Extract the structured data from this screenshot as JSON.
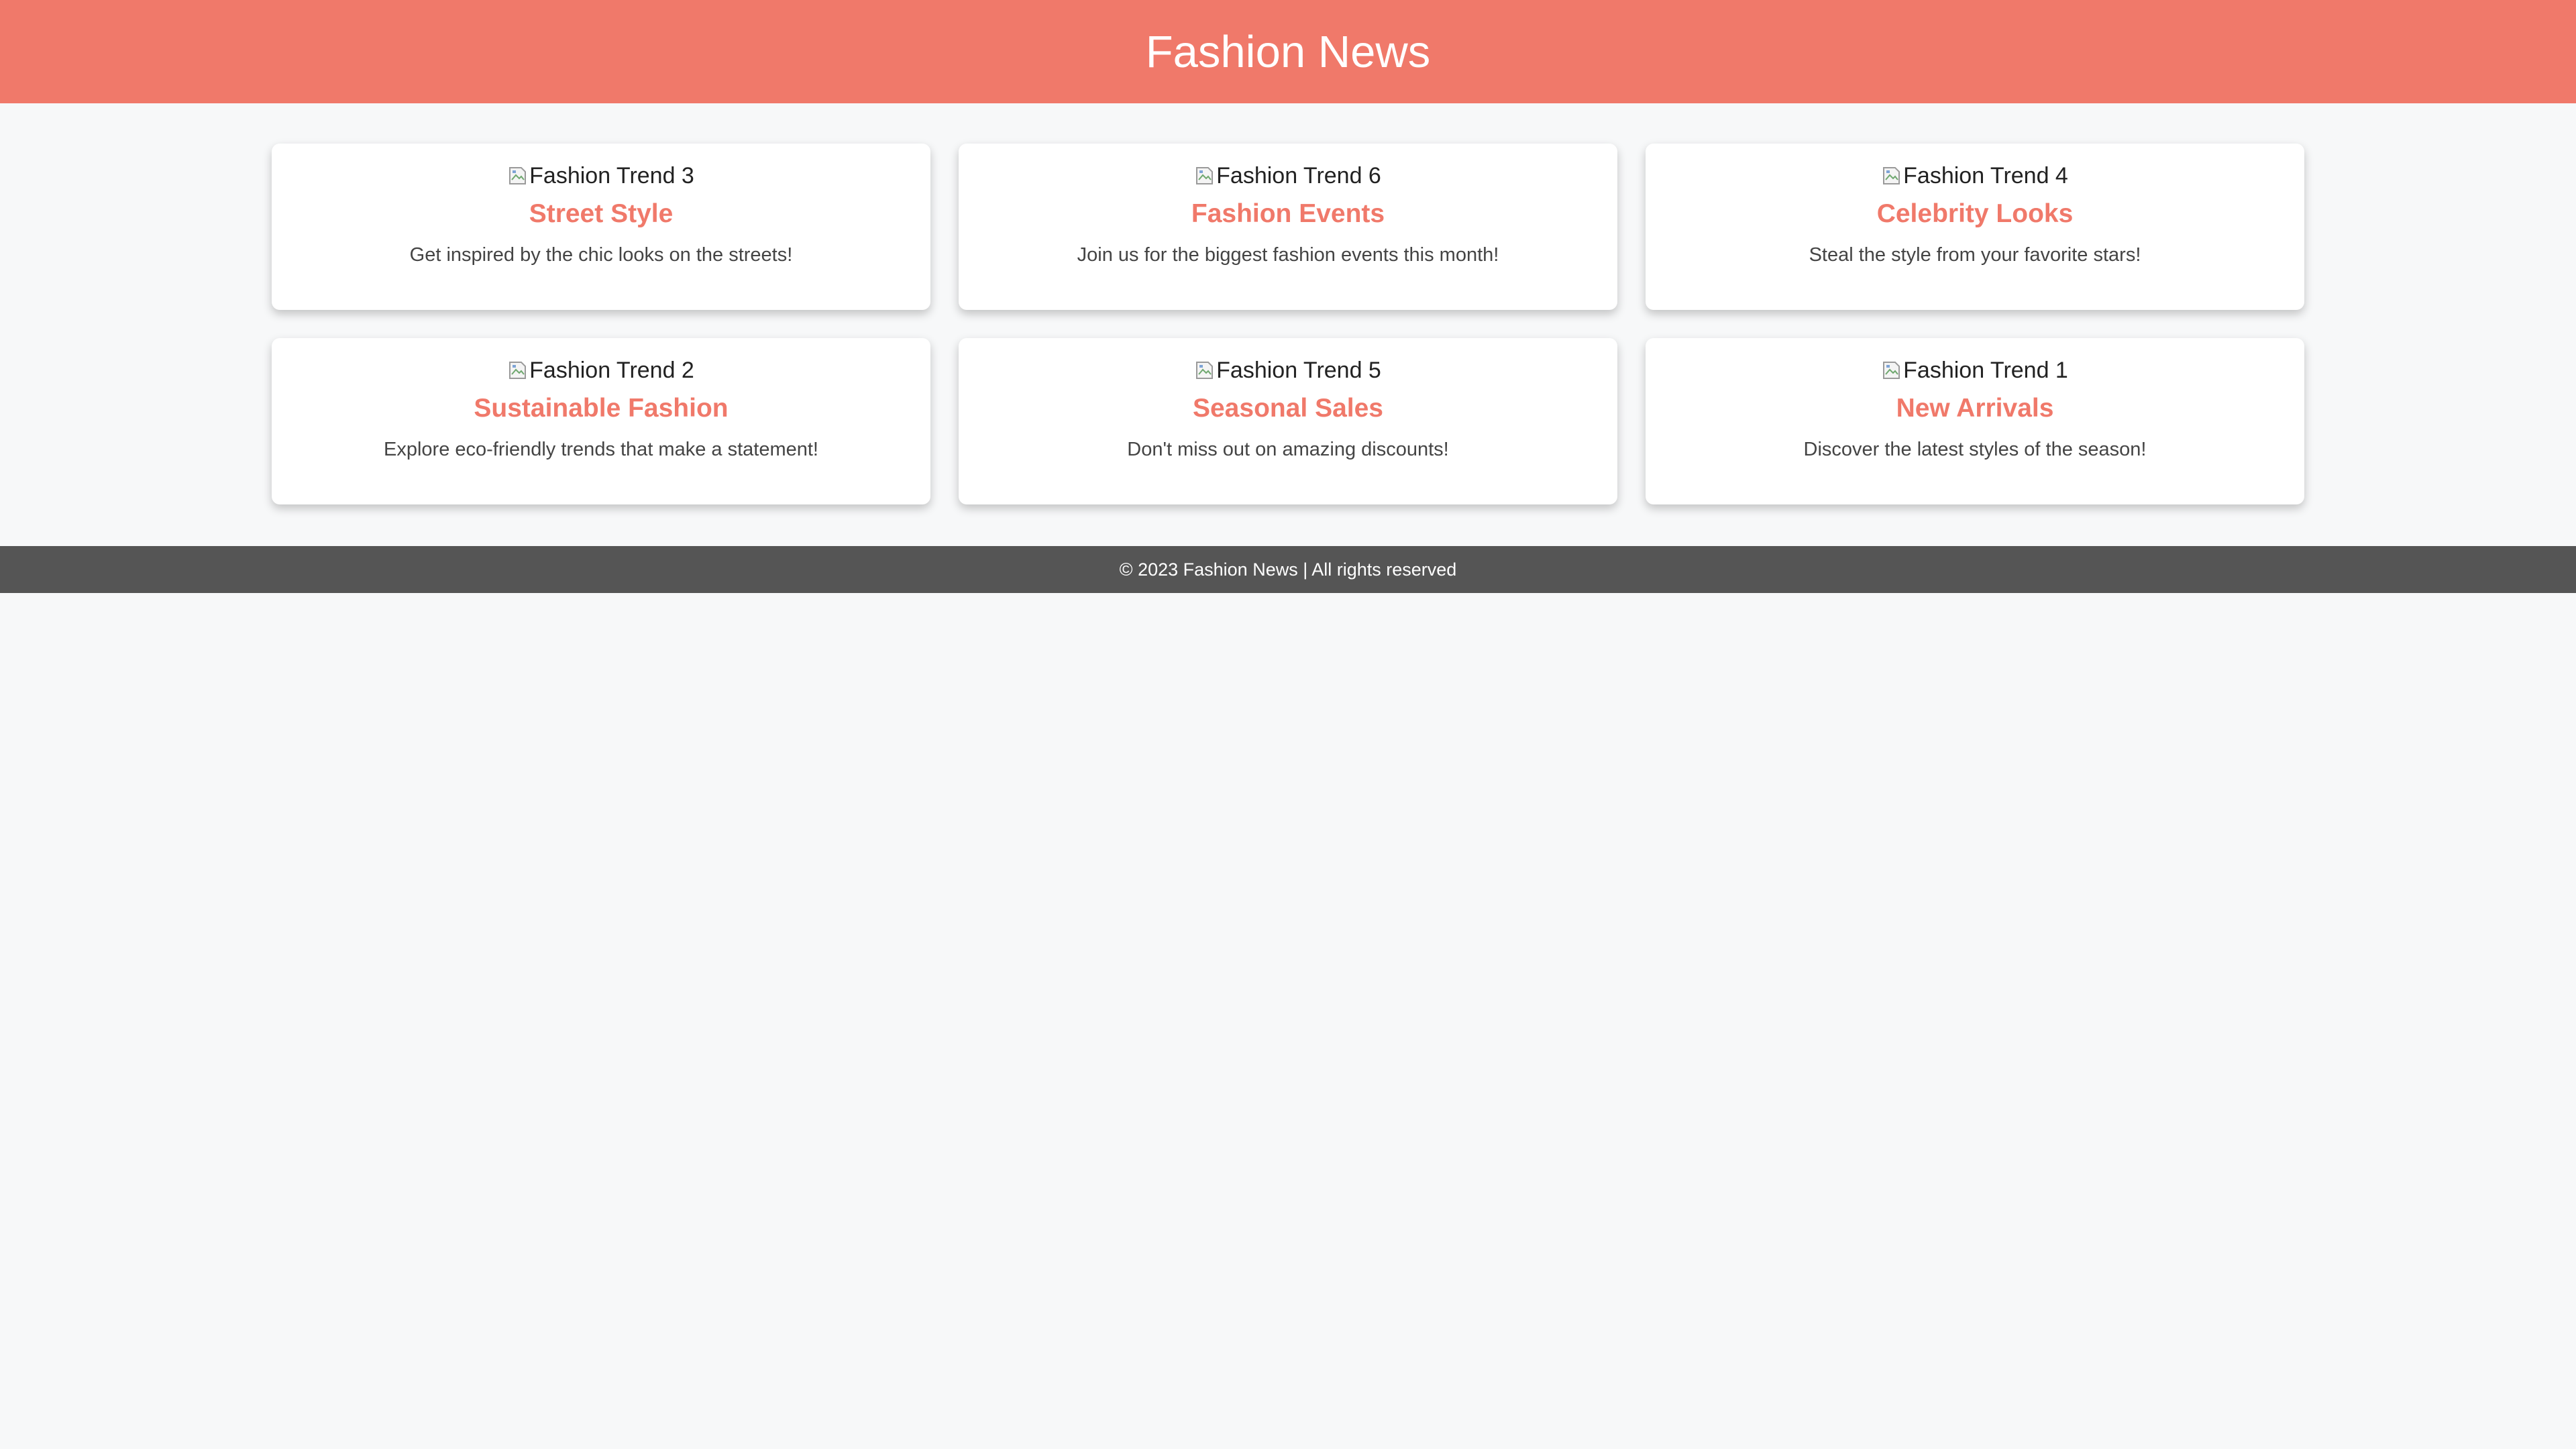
{
  "header": {
    "title": "Fashion News"
  },
  "cards": [
    {
      "image_alt": "Fashion Trend 3",
      "title": "Street Style",
      "description": "Get inspired by the chic looks on the streets!"
    },
    {
      "image_alt": "Fashion Trend 6",
      "title": "Fashion Events",
      "description": "Join us for the biggest fashion events this month!"
    },
    {
      "image_alt": "Fashion Trend 4",
      "title": "Celebrity Looks",
      "description": "Steal the style from your favorite stars!"
    },
    {
      "image_alt": "Fashion Trend 2",
      "title": "Sustainable Fashion",
      "description": "Explore eco-friendly trends that make a statement!"
    },
    {
      "image_alt": "Fashion Trend 5",
      "title": "Seasonal Sales",
      "description": "Don't miss out on amazing discounts!"
    },
    {
      "image_alt": "Fashion Trend 1",
      "title": "New Arrivals",
      "description": "Discover the latest styles of the season!"
    }
  ],
  "footer": {
    "text": "© 2023 Fashion News | All rights reserved"
  },
  "colors": {
    "accent": "#f0796a",
    "background": "#f7f8f9",
    "footer_bg": "#555555"
  },
  "icons": {
    "image": "broken-image-icon"
  }
}
